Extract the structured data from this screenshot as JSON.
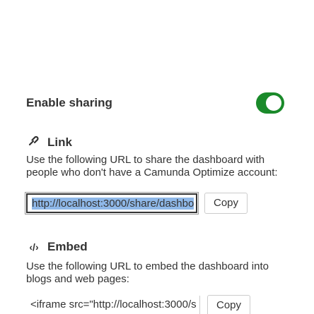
{
  "sharing": {
    "title": "Enable sharing",
    "enabled": true,
    "toggle_color": "#1a8a2a",
    "toggle_icon": "toggle-switch"
  },
  "link_section": {
    "icon": "link-icon",
    "heading": "Link",
    "description": "Use the following URL to share the dashboard with people who don't have a Camunda Optimize account:",
    "url": "http://localhost:3000/share/dashbo",
    "copy_label": "Copy"
  },
  "embed_section": {
    "icon": "code-icon",
    "heading": "Embed",
    "description": "Use the following URL to embed the dashboard into blogs and web pages:",
    "code": "<iframe src=\"http://localhost:3000/s",
    "copy_label": "Copy"
  }
}
